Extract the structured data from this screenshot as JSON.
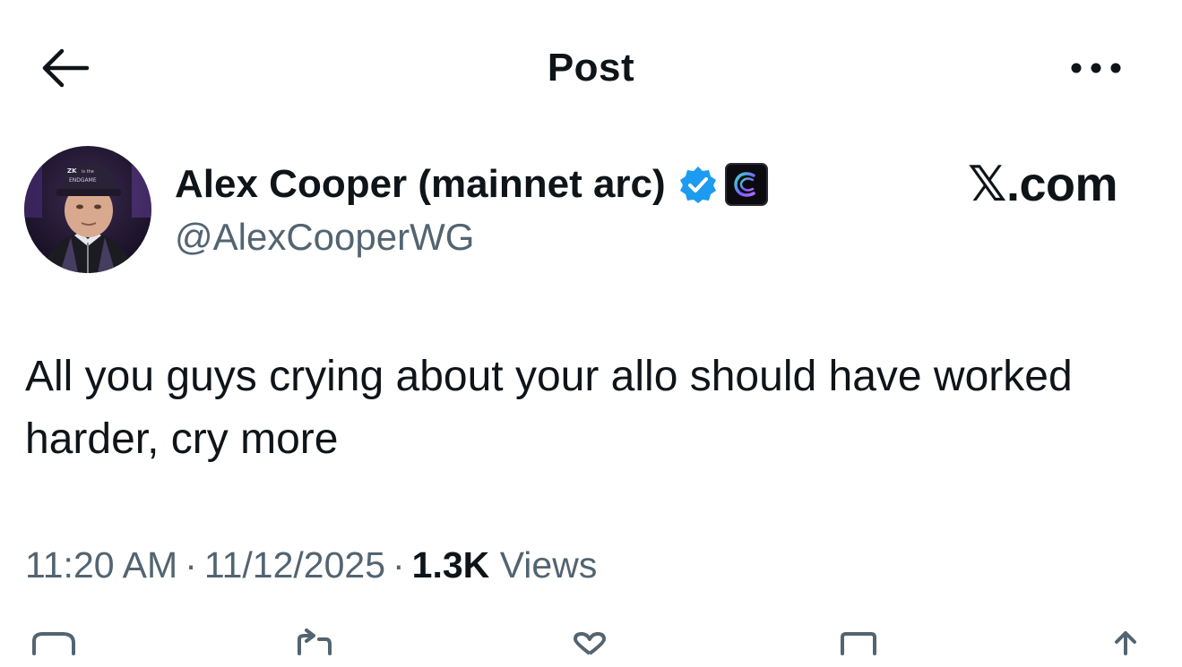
{
  "header": {
    "title": "Post",
    "back_icon": "arrow-left-icon",
    "more_icon": "more-horizontal-icon"
  },
  "author": {
    "name": "Alex Cooper (mainnet arc)",
    "handle": "@AlexCooperWG",
    "verified_icon": "verified-badge-icon",
    "affiliate_icon": "affiliate-logo-icon",
    "avatar_cap_text": "ZK is the ENDGAME"
  },
  "source_mark": "𝕏.com",
  "post": {
    "text": "All you guys crying about your allo should have worked harder, cry more"
  },
  "meta": {
    "time": "11:20 AM",
    "date": "11/12/2025",
    "views_count": "1.3K",
    "views_label": "Views",
    "separator": "·"
  },
  "actions": {
    "icons": [
      "reply-icon",
      "repost-icon",
      "like-icon",
      "bookmark-icon",
      "share-icon"
    ]
  },
  "colors": {
    "text_primary": "#0f1419",
    "text_secondary": "#536471",
    "verified_blue": "#1d9bf0"
  }
}
